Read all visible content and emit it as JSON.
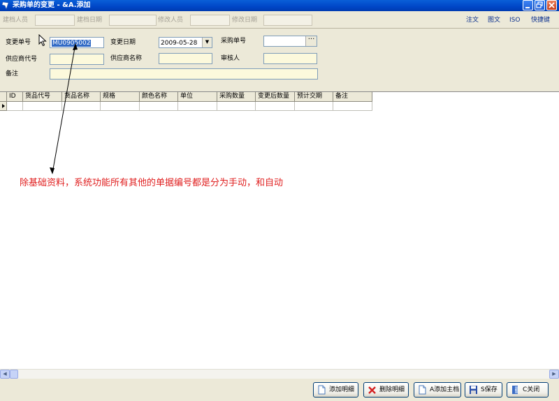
{
  "window": {
    "title": "采购单的变更 - &A.添加"
  },
  "toolbar": {
    "created_by_label": "建档人员",
    "created_date_label": "建档日期",
    "modified_by_label": "修改人员",
    "modified_date_label": "修改日期",
    "links": [
      "注文",
      "图文",
      "ISO",
      "快捷键"
    ]
  },
  "form": {
    "change_no_label": "变更单号",
    "change_no_value": "MU0905002",
    "change_date_label": "变更日期",
    "change_date_value": "2009-05-28",
    "po_no_label": "采购单号",
    "supplier_code_label": "供应商代号",
    "supplier_name_label": "供应商名称",
    "reviewer_label": "审核人",
    "remark_label": "备注"
  },
  "grid": {
    "columns": [
      "ID",
      "货品代号",
      "货品名称",
      "规格",
      "颜色名称",
      "单位",
      "采购数量",
      "变更后数量",
      "预计交期",
      "备注"
    ]
  },
  "annotation": "除基础资料，系统功能所有其他的单据编号都是分为手动，和自动",
  "buttons": {
    "add_detail": "添加明细",
    "delete_detail": "删除明细",
    "add_master": "A添加主档",
    "save": "S保存",
    "close": "C关闭"
  },
  "colors": {
    "titlebar": "#0046c7",
    "annotation": "#e02020",
    "input_yellow": "#fcf9dc"
  }
}
